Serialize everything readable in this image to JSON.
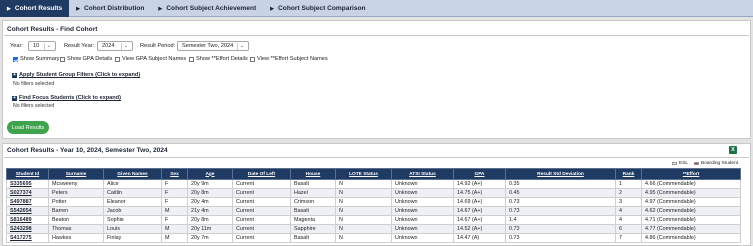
{
  "tabs": [
    {
      "label": "Cohort Results",
      "active": true
    },
    {
      "label": "Cohort Distribution",
      "active": false
    },
    {
      "label": "Cohort Subject Achievement",
      "active": false
    },
    {
      "label": "Cohort Subject Comparison",
      "active": false
    }
  ],
  "find": {
    "title": "Cohort Results - Find Cohort",
    "year_label": "Year:",
    "year_value": "10",
    "result_year_label": "Result Year:",
    "result_year_value": "2024",
    "result_period_label": "Result Period:",
    "result_period_value": "Semester Two, 2024",
    "checkboxes": [
      {
        "label": "Show Summary",
        "checked": true
      },
      {
        "label": "Show GPA Details",
        "checked": false
      },
      {
        "label": "View GPA Subject Names",
        "checked": false
      },
      {
        "label": "Show **Effort Details",
        "checked": false
      },
      {
        "label": "View **Effort Subject Names",
        "checked": false
      }
    ],
    "group_filters_label": "Apply Student Group Filters (Click to expand)",
    "group_filters_note": "No filters selected",
    "focus_label": "Find Focus Students (Click to expand)",
    "focus_note": "No filters selected",
    "load_label": "Load Results"
  },
  "results": {
    "title": "Cohort Results - Year 10, 2024, Semester Two, 2024",
    "excel_icon": "X",
    "legend": [
      {
        "label": "ESL",
        "color": "#fde4e6"
      },
      {
        "label": "Boarding Student",
        "color": "#c0392b"
      }
    ],
    "columns": [
      "Student Id",
      "Surname",
      "Given Names",
      "Sex",
      "Age",
      "Date Of Left",
      "House",
      "LOTE Status",
      "ATSI Status",
      "GPA",
      "Result Std Deviation",
      "Rank",
      "**Effort"
    ],
    "rows": [
      [
        "S335695",
        "Mcsweeny",
        "Alice",
        "F",
        "20y 9m",
        "Current",
        "Basalt",
        "N",
        "Unknown",
        "14.92 (A+)",
        "0.35",
        "1",
        "4.66 (Commendable)"
      ],
      [
        "S027374",
        "Peters",
        "Caitlin",
        "F",
        "20y 8m",
        "Current",
        "Hazel",
        "N",
        "Unknown",
        "14.75 (A+)",
        "0.45",
        "2",
        "4.95 (Commendable)"
      ],
      [
        "S497887",
        "Potter",
        "Eleanor",
        "F",
        "20y 4m",
        "Current",
        "Crimson",
        "N",
        "Unknown",
        "14.69 (A+)",
        "0.73",
        "3",
        "4.97 (Commendable)"
      ],
      [
        "S542654",
        "Barren",
        "Jacob",
        "M",
        "21y 4m",
        "Current",
        "Basalt",
        "N",
        "Unknown",
        "14.67 (A+)",
        "0.73",
        "4",
        "4.62 (Commendable)"
      ],
      [
        "S816489",
        "Beaton",
        "Sophie",
        "F",
        "20y 8m",
        "Current",
        "Magenta",
        "N",
        "Unknown",
        "14.67 (A+)",
        "1.4",
        "4",
        "4.71 (Commendable)"
      ],
      [
        "S243298",
        "Thomas",
        "Louis",
        "M",
        "20y 11m",
        "Current",
        "Sapphire",
        "N",
        "Unknown",
        "14.52 (A+)",
        "0.73",
        "6",
        "4.77 (Commendable)"
      ],
      [
        "S417275",
        "Hawkes",
        "Finlay",
        "M",
        "20y 7m",
        "Current",
        "Basalt",
        "N",
        "Unknown",
        "14.47 (A)",
        "0.73",
        "7",
        "4.86 (Commendable)"
      ]
    ]
  }
}
